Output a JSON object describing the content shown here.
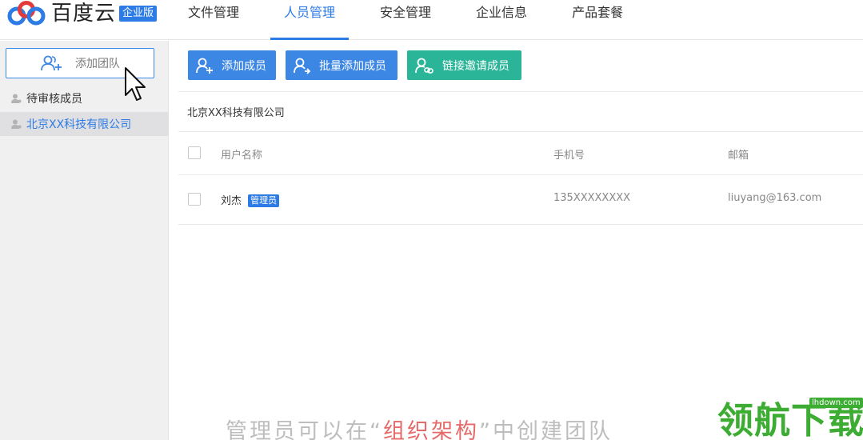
{
  "header": {
    "logo_text": "百度云",
    "logo_badge": "企业版",
    "nav": [
      {
        "label": "文件管理"
      },
      {
        "label": "人员管理"
      },
      {
        "label": "安全管理"
      },
      {
        "label": "企业信息"
      },
      {
        "label": "产品套餐"
      }
    ],
    "active_nav": "人员管理"
  },
  "sidebar": {
    "add_team_label": "添加团队",
    "items": [
      {
        "label": "待审核成员"
      },
      {
        "label": "北京XX科技有限公司"
      }
    ],
    "selected_item": "北京XX科技有限公司"
  },
  "toolbar": {
    "add_member": "添加成员",
    "bulk_add_member": "批量添加成员",
    "link_invite": "链接邀请成员"
  },
  "main": {
    "org_title": "北京XX科技有限公司",
    "table": {
      "headers": [
        "用户名称",
        "手机号",
        "邮箱"
      ],
      "rows": [
        {
          "name": "刘杰",
          "badge": "管理员",
          "phone": "135XXXXXXXX",
          "email": "liuyang@163.com"
        }
      ]
    }
  },
  "caption": {
    "before": "管理员可以在",
    "quote_open": "“",
    "highlight": "组织架构",
    "quote_close": "”",
    "after": "中创建团队"
  },
  "watermark": {
    "text": "领航下载",
    "url": "lhdown.com"
  },
  "colors": {
    "accent": "#2d7be5",
    "button_blue": "#3d87e4",
    "button_green": "#2bb598",
    "caption_highlight": "#e56a6a",
    "watermark_green": "#3dac33"
  },
  "icons": {
    "logo": "baidu-cloud-logo",
    "add_team": "users-add-icon",
    "pending": "user-icon",
    "company": "user-icon",
    "add_member": "user-add-icon",
    "bulk_add": "user-add-icon",
    "link_invite": "user-link-icon",
    "cursor": "mouse-pointer-icon"
  }
}
